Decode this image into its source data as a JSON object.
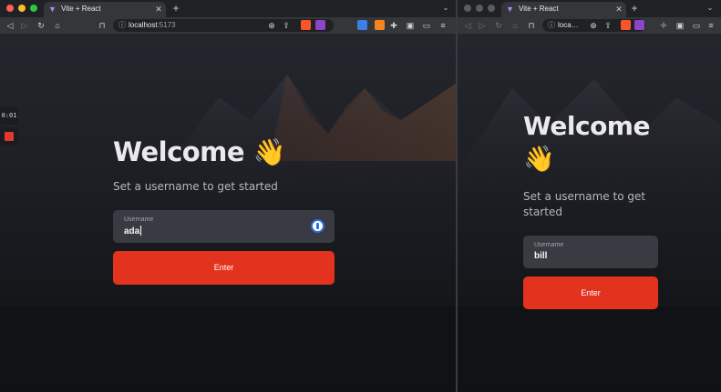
{
  "colors": {
    "accent": "#e3321d",
    "background": "#16171c",
    "field": "#3a3b42"
  },
  "left": {
    "tab": {
      "title": "Vite + React",
      "favicon": "vite-icon"
    },
    "address": {
      "host": "localhost",
      "port": ":5173"
    },
    "recorder": {
      "time": "0:01"
    },
    "page": {
      "heading": "Welcome",
      "emoji": "👋",
      "subtitle": "Set a username to get started",
      "field_label": "Username",
      "field_value": "ada",
      "button_label": "Enter"
    }
  },
  "right": {
    "tab": {
      "title": "Vite + React",
      "favicon": "vite-icon"
    },
    "address": {
      "host": "loca…"
    },
    "page": {
      "heading": "Welcome",
      "emoji": "👋",
      "subtitle_line1": "Set a username to get",
      "subtitle_line2": "started",
      "field_label": "Username",
      "field_value": "bill",
      "button_label": "Enter"
    }
  }
}
